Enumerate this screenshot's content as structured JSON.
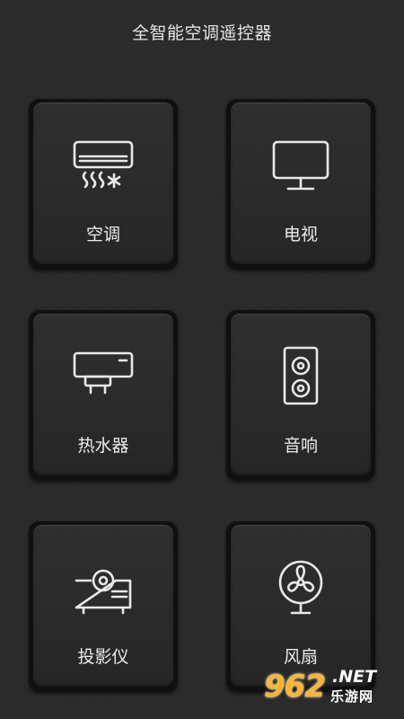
{
  "header": {
    "title": "全智能空调遥控器"
  },
  "devices": [
    {
      "label": "空调",
      "icon": "air-conditioner-icon"
    },
    {
      "label": "电视",
      "icon": "tv-icon"
    },
    {
      "label": "热水器",
      "icon": "water-heater-icon"
    },
    {
      "label": "音响",
      "icon": "speaker-icon"
    },
    {
      "label": "投影仪",
      "icon": "projector-icon"
    },
    {
      "label": "风扇",
      "icon": "fan-icon"
    }
  ],
  "watermark": {
    "logo": "962",
    "suffix": ".NET",
    "site": "乐游网"
  },
  "colors": {
    "background": "#2b2b2b",
    "tile": "#2c2c2c",
    "text": "#e9e9e9",
    "watermark_accent": "#ffb52b"
  }
}
